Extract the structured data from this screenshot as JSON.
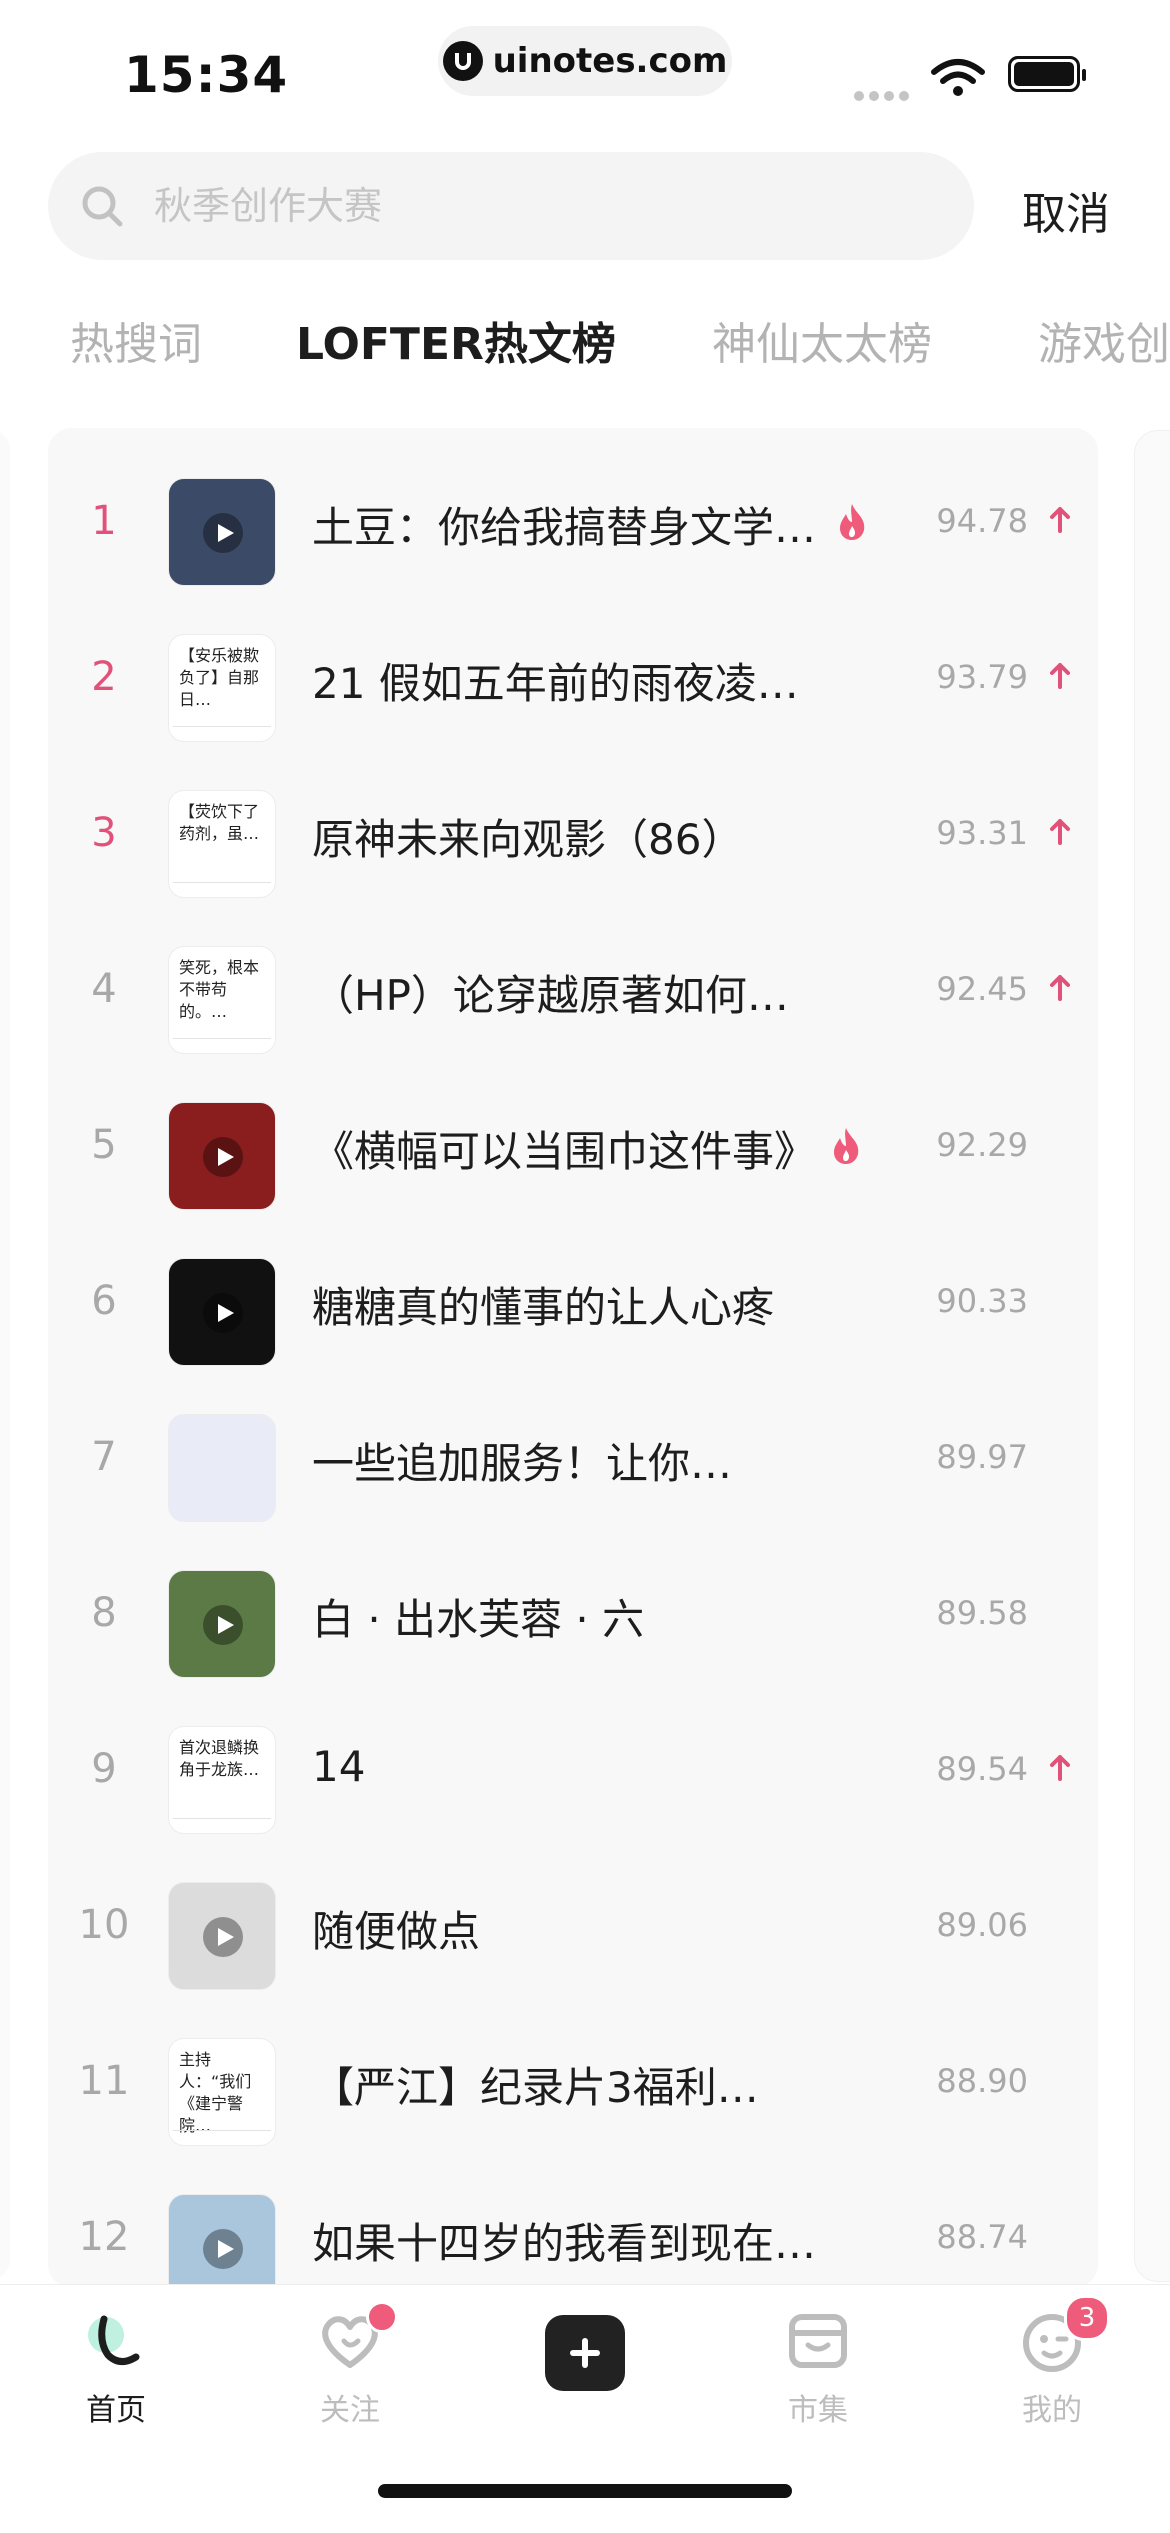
{
  "status_bar": {
    "time": "15:34",
    "url": "uinotes.com"
  },
  "search": {
    "placeholder": "秋季创作大赛",
    "cancel_label": "取消"
  },
  "tabs": [
    {
      "label": "热搜词",
      "active": false
    },
    {
      "label": "LOFTER热文榜",
      "active": true
    },
    {
      "label": "神仙太太榜",
      "active": false
    },
    {
      "label": "游戏创",
      "active": false
    }
  ],
  "ranking": [
    {
      "rank": "1",
      "title": "土豆：你给我搞替身文学…",
      "score": "94.78",
      "hot": true,
      "trend_up": true,
      "thumb": {
        "kind": "video",
        "color": "#3b4a66"
      }
    },
    {
      "rank": "2",
      "title": "21 假如五年前的雨夜凌…",
      "score": "93.79",
      "hot": false,
      "trend_up": true,
      "thumb": {
        "kind": "text",
        "text": "【安乐被欺负了】自那日…"
      }
    },
    {
      "rank": "3",
      "title": "原神未来向观影（86）",
      "score": "93.31",
      "hot": false,
      "trend_up": true,
      "thumb": {
        "kind": "text",
        "text": "【荧饮下了药剂，虽…"
      }
    },
    {
      "rank": "4",
      "title": "（HP）论穿越原著如何…",
      "score": "92.45",
      "hot": false,
      "trend_up": true,
      "thumb": {
        "kind": "text",
        "text": "笑死，根本不带苟的。…"
      }
    },
    {
      "rank": "5",
      "title": "《横幅可以当围巾这件事》",
      "score": "92.29",
      "hot": true,
      "trend_up": false,
      "thumb": {
        "kind": "video",
        "color": "#8a1d1d"
      }
    },
    {
      "rank": "6",
      "title": "糖糖真的懂事的让人心疼",
      "score": "90.33",
      "hot": false,
      "trend_up": false,
      "thumb": {
        "kind": "video",
        "color": "#111111"
      }
    },
    {
      "rank": "7",
      "title": "一些追加服务！让你…",
      "score": "89.97",
      "hot": false,
      "trend_up": false,
      "thumb": {
        "kind": "image",
        "color": "#e9ecf6"
      }
    },
    {
      "rank": "8",
      "title": "白 · 出水芙蓉 · 六",
      "score": "89.58",
      "hot": false,
      "trend_up": false,
      "thumb": {
        "kind": "video",
        "color": "#5b7a46"
      }
    },
    {
      "rank": "9",
      "title": "14",
      "score": "89.54",
      "hot": false,
      "trend_up": true,
      "thumb": {
        "kind": "text",
        "text": "首次退鳞换角于龙族…"
      }
    },
    {
      "rank": "10",
      "title": "随便做点",
      "score": "89.06",
      "hot": false,
      "trend_up": false,
      "thumb": {
        "kind": "video",
        "color": "#dcdcdc"
      }
    },
    {
      "rank": "11",
      "title": "【严江】纪录片3福利…",
      "score": "88.90",
      "hot": false,
      "trend_up": false,
      "thumb": {
        "kind": "text",
        "text": "主持人：“我们《建宁警院…"
      }
    },
    {
      "rank": "12",
      "title": "如果十四岁的我看到现在…",
      "score": "88.74",
      "hot": false,
      "trend_up": false,
      "thumb": {
        "kind": "video",
        "color": "#a9c6dd"
      }
    }
  ],
  "bottom_nav": {
    "home": "首页",
    "follow": "关注",
    "market": "市集",
    "mine": "我的",
    "mine_badge": "3"
  },
  "colors": {
    "accent": "#e1527a",
    "badge": "#ef5b7b",
    "muted": "#a8a8a8"
  }
}
